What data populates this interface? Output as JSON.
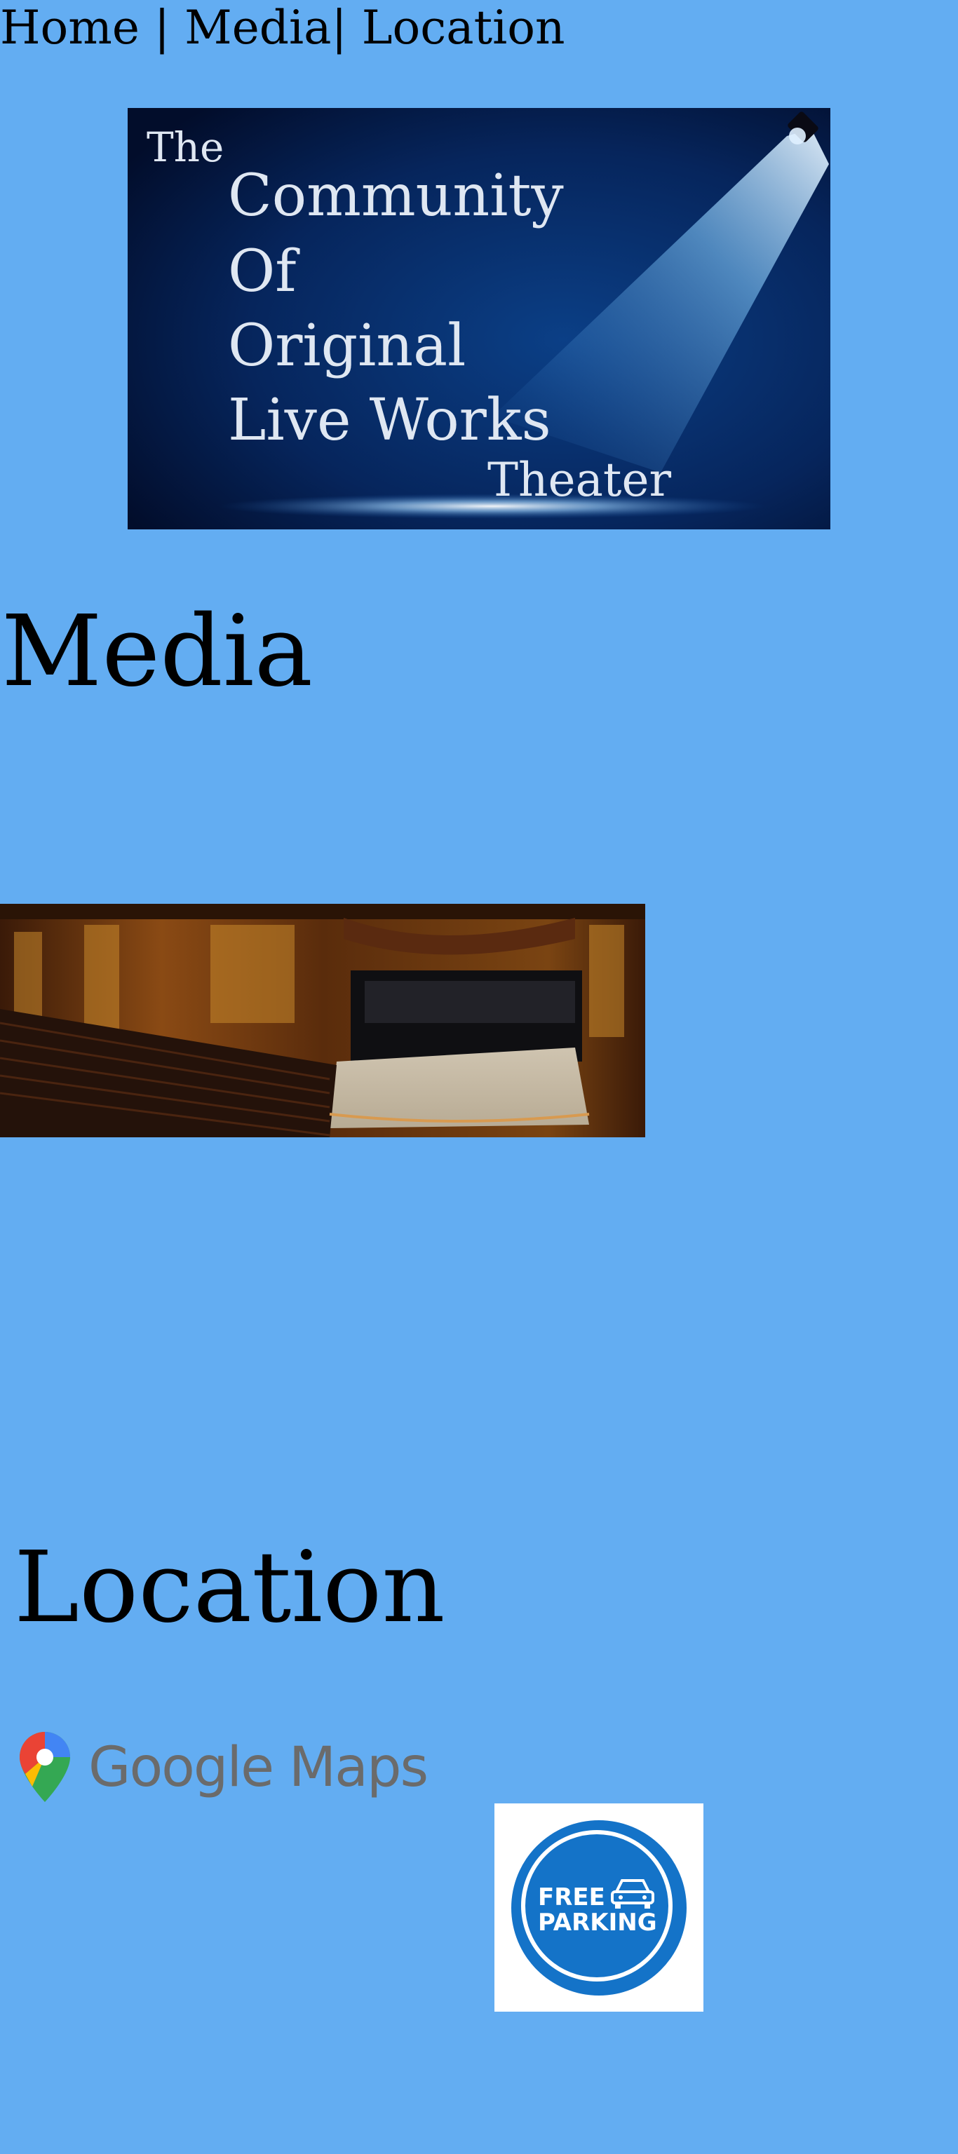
{
  "nav": {
    "home": "Home",
    "sep1": " | ",
    "media": "Media",
    "sep2": "| ",
    "location": "Location"
  },
  "banner": {
    "the": "The",
    "line1": "Community",
    "line2": "Of",
    "line3": "Original",
    "line4": "Live Works",
    "theater": "Theater"
  },
  "sections": {
    "media_heading": "Media",
    "location_heading": "Location"
  },
  "maps": {
    "label": "Google Maps",
    "icon": "map-pin-icon"
  },
  "parking": {
    "text": "FREE\nPARKING",
    "icon": "car-icon"
  },
  "colors": {
    "page_background": "#63adf2",
    "banner_dark": "#03133a",
    "parking_blue": "#1473c8"
  }
}
